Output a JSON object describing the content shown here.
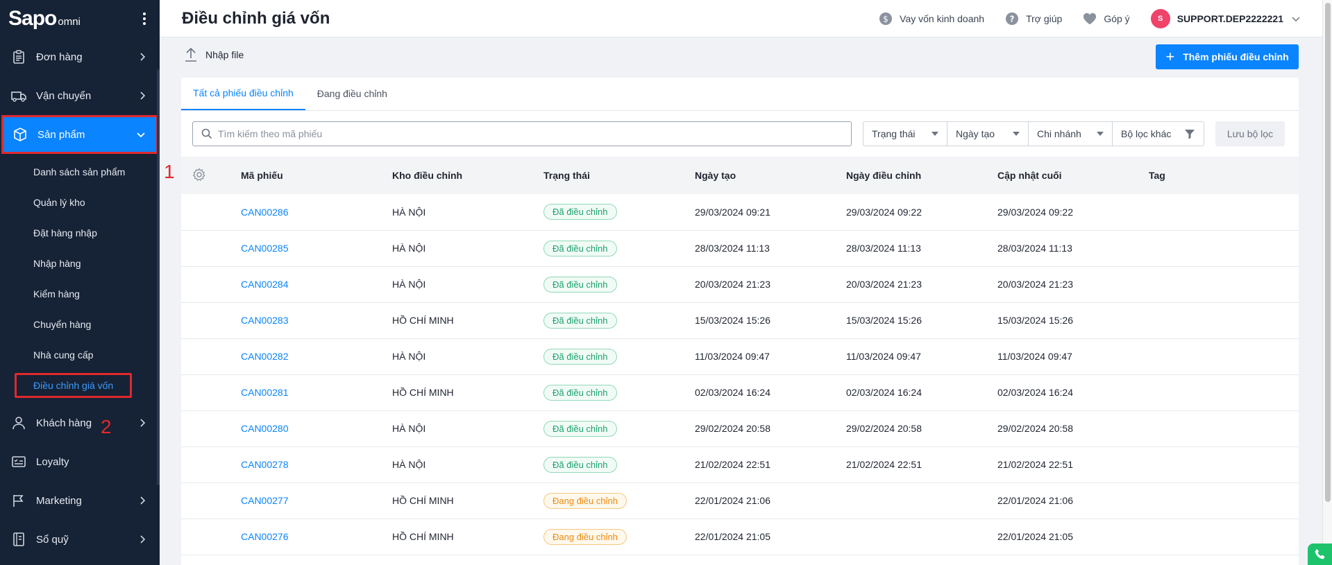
{
  "brand": {
    "logo_main": "Sapo",
    "logo_sub": "omni"
  },
  "sidebar": {
    "items": [
      {
        "label": "Đơn hàng",
        "icon": "clipboard-icon"
      },
      {
        "label": "Vận chuyển",
        "icon": "truck-icon"
      },
      {
        "label": "Sản phẩm",
        "icon": "box-icon"
      },
      {
        "label": "Khách hàng",
        "icon": "user-icon"
      },
      {
        "label": "Loyalty",
        "icon": "card-icon"
      },
      {
        "label": "Marketing",
        "icon": "flag-icon"
      },
      {
        "label": "Sổ quỹ",
        "icon": "ledger-icon"
      }
    ],
    "subitems": [
      "Danh sách sản phẩm",
      "Quản lý kho",
      "Đặt hàng nhập",
      "Nhập hàng",
      "Kiểm hàng",
      "Chuyển hàng",
      "Nhà cung cấp",
      "Điều chỉnh giá vốn"
    ],
    "annotation_1": "1",
    "annotation_2": "2"
  },
  "header": {
    "title": "Điều chỉnh giá vốn",
    "loan": "Vay vốn kinh doanh",
    "help": "Trợ giúp",
    "feedback": "Góp ý",
    "avatar_letter": "S",
    "username": "SUPPORT.DEP2222221"
  },
  "actions": {
    "import": "Nhập file",
    "add": "Thêm phiếu điều chỉnh"
  },
  "tabs": [
    "Tất cả phiếu điều chỉnh",
    "Đang điều chỉnh"
  ],
  "filters": {
    "search_placeholder": "Tìm kiếm theo mã phiếu",
    "status": "Trạng thái",
    "created": "Ngày tạo",
    "branch": "Chi nhánh",
    "other": "Bộ lọc khác",
    "save": "Lưu bộ lọc"
  },
  "table": {
    "headers": [
      "Mã phiếu",
      "Kho điều chỉnh",
      "Trạng thái",
      "Ngày tạo",
      "Ngày điều chỉnh",
      "Cập nhật cuối",
      "Tag"
    ],
    "rows": [
      {
        "code": "CAN00286",
        "store": "HÀ NỘI",
        "status": "Đã điều chỉnh",
        "state": "done",
        "created": "29/03/2024 09:21",
        "adjusted": "29/03/2024 09:22",
        "updated": "29/03/2024 09:22"
      },
      {
        "code": "CAN00285",
        "store": "HÀ NỘI",
        "status": "Đã điều chỉnh",
        "state": "done",
        "created": "28/03/2024 11:13",
        "adjusted": "28/03/2024 11:13",
        "updated": "28/03/2024 11:13"
      },
      {
        "code": "CAN00284",
        "store": "HÀ NỘI",
        "status": "Đã điều chỉnh",
        "state": "done",
        "created": "20/03/2024 21:23",
        "adjusted": "20/03/2024 21:23",
        "updated": "20/03/2024 21:23"
      },
      {
        "code": "CAN00283",
        "store": "HỒ CHÍ MINH",
        "status": "Đã điều chỉnh",
        "state": "done",
        "created": "15/03/2024 15:26",
        "adjusted": "15/03/2024 15:26",
        "updated": "15/03/2024 15:26"
      },
      {
        "code": "CAN00282",
        "store": "HÀ NỘI",
        "status": "Đã điều chỉnh",
        "state": "done",
        "created": "11/03/2024 09:47",
        "adjusted": "11/03/2024 09:47",
        "updated": "11/03/2024 09:47"
      },
      {
        "code": "CAN00281",
        "store": "HỒ CHÍ MINH",
        "status": "Đã điều chỉnh",
        "state": "done",
        "created": "02/03/2024 16:24",
        "adjusted": "02/03/2024 16:24",
        "updated": "02/03/2024 16:24"
      },
      {
        "code": "CAN00280",
        "store": "HÀ NỘI",
        "status": "Đã điều chỉnh",
        "state": "done",
        "created": "29/02/2024 20:58",
        "adjusted": "29/02/2024 20:58",
        "updated": "29/02/2024 20:58"
      },
      {
        "code": "CAN00278",
        "store": "HÀ NỘI",
        "status": "Đã điều chỉnh",
        "state": "done",
        "created": "21/02/2024 22:51",
        "adjusted": "21/02/2024 22:51",
        "updated": "21/02/2024 22:51"
      },
      {
        "code": "CAN00277",
        "store": "HỒ CHÍ MINH",
        "status": "Đang điều chỉnh",
        "state": "pending",
        "created": "22/01/2024 21:06",
        "adjusted": "",
        "updated": "22/01/2024 21:06"
      },
      {
        "code": "CAN00276",
        "store": "HỒ CHÍ MINH",
        "status": "Đang điều chỉnh",
        "state": "pending",
        "created": "22/01/2024 21:05",
        "adjusted": "",
        "updated": "22/01/2024 21:05"
      }
    ]
  },
  "colors": {
    "sidebar_bg": "#162235",
    "primary": "#0a84ff",
    "highlight": "#e0292e",
    "success": "#1aa06d",
    "warning": "#e98b12"
  }
}
